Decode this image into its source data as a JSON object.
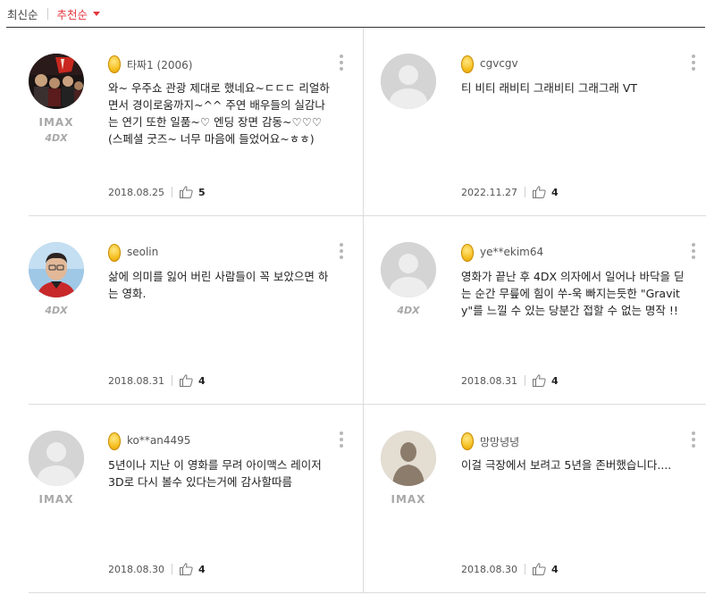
{
  "sort": {
    "latest": "최신순",
    "recommended": "추천순"
  },
  "reviews": [
    {
      "nickname": "타짜1 (2006)",
      "text": "와~ 우주쇼 관광 제대로 했네요~ㄷㄷㄷ 리얼하면서 경이로움까지~^^ 주연 배우들의 실감나는 연기 또한 일품~♡ 엔딩 장면 감동~♡♡♡ (스페셜 굿즈~ 너무 마음에 들었어요~ㅎㅎ)",
      "date": "2018.08.25",
      "likes": "5",
      "badges": [
        "IMAX",
        "4DX"
      ],
      "avatar": "movie-poster"
    },
    {
      "nickname": "cgvcgv",
      "text": "티 비티 래비티 그래비티 그래그래 VT",
      "date": "2022.11.27",
      "likes": "4",
      "badges": [],
      "avatar": "default-user"
    },
    {
      "nickname": "seolin",
      "text": "삶에 의미를 잃어 버린 사람들이 꼭 보았으면 하는 영화.",
      "date": "2018.08.31",
      "likes": "4",
      "badges": [
        "4DX"
      ],
      "avatar": "person-photo"
    },
    {
      "nickname": "ye**ekim64",
      "text": "영화가 끝난 후 4DX 의자에서 일어나 바닥을 딛는 순간 무릎에 힘이 쑤-욱 빠지는듯한 \"Gravity\"를 느낄 수 있는 당분간 접할 수 없는 명작 !!",
      "date": "2018.08.31",
      "likes": "4",
      "badges": [
        "4DX"
      ],
      "avatar": "default-user"
    },
    {
      "nickname": "ko**an4495",
      "text": "5년이나 지난 이 영화를 무려 아이맥스 레이저 3D로 다시 볼수 있다는거에 감사할따름",
      "date": "2018.08.30",
      "likes": "4",
      "badges": [
        "IMAX"
      ],
      "avatar": "default-user"
    },
    {
      "nickname": "망망녕녕",
      "text": "이걸 극장에서 보려고 5년을 존버했습니다....",
      "date": "2018.08.30",
      "likes": "4",
      "badges": [
        "IMAX"
      ],
      "avatar": "silhouette-user"
    }
  ],
  "colors": {
    "accent": "#e4363d",
    "coin": "#f5bd1c",
    "badge": "#a8a8a8"
  }
}
